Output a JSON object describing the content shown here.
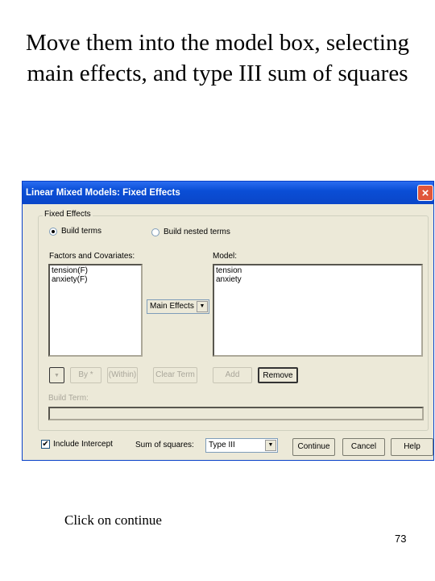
{
  "slide": {
    "title": "Move them into the model box, selecting main effects, and type III sum of squares",
    "caption": "Click on continue",
    "page_number": "73"
  },
  "dialog": {
    "title": "Linear Mixed Models: Fixed Effects",
    "close_icon": "×",
    "group_label": "Fixed Effects",
    "radio_build_terms": "Build terms",
    "radio_build_nested": "Build nested terms",
    "selected_radio": "Build terms",
    "factors_label": "Factors and Covariates:",
    "factors": [
      "tension(F)",
      "anxiety(F)"
    ],
    "model_label": "Model:",
    "model": [
      "tension",
      "anxiety"
    ],
    "term_type": "Main Effects",
    "buttons": {
      "by": "By *",
      "within": "(Within)",
      "clear_term": "Clear Term",
      "add": "Add",
      "remove": "Remove",
      "continue": "Continue",
      "cancel": "Cancel",
      "help": "Help"
    },
    "build_term_label": "Build Term:",
    "build_term_value": "",
    "include_intercept_label": "Include Intercept",
    "include_intercept_checked": true,
    "sum_of_squares_label": "Sum of squares:",
    "sum_of_squares_value": "Type III",
    "colors": {
      "titlebar": "#0a4ed6",
      "dialog_bg": "#ece9d8",
      "close": "#e0563a"
    }
  }
}
